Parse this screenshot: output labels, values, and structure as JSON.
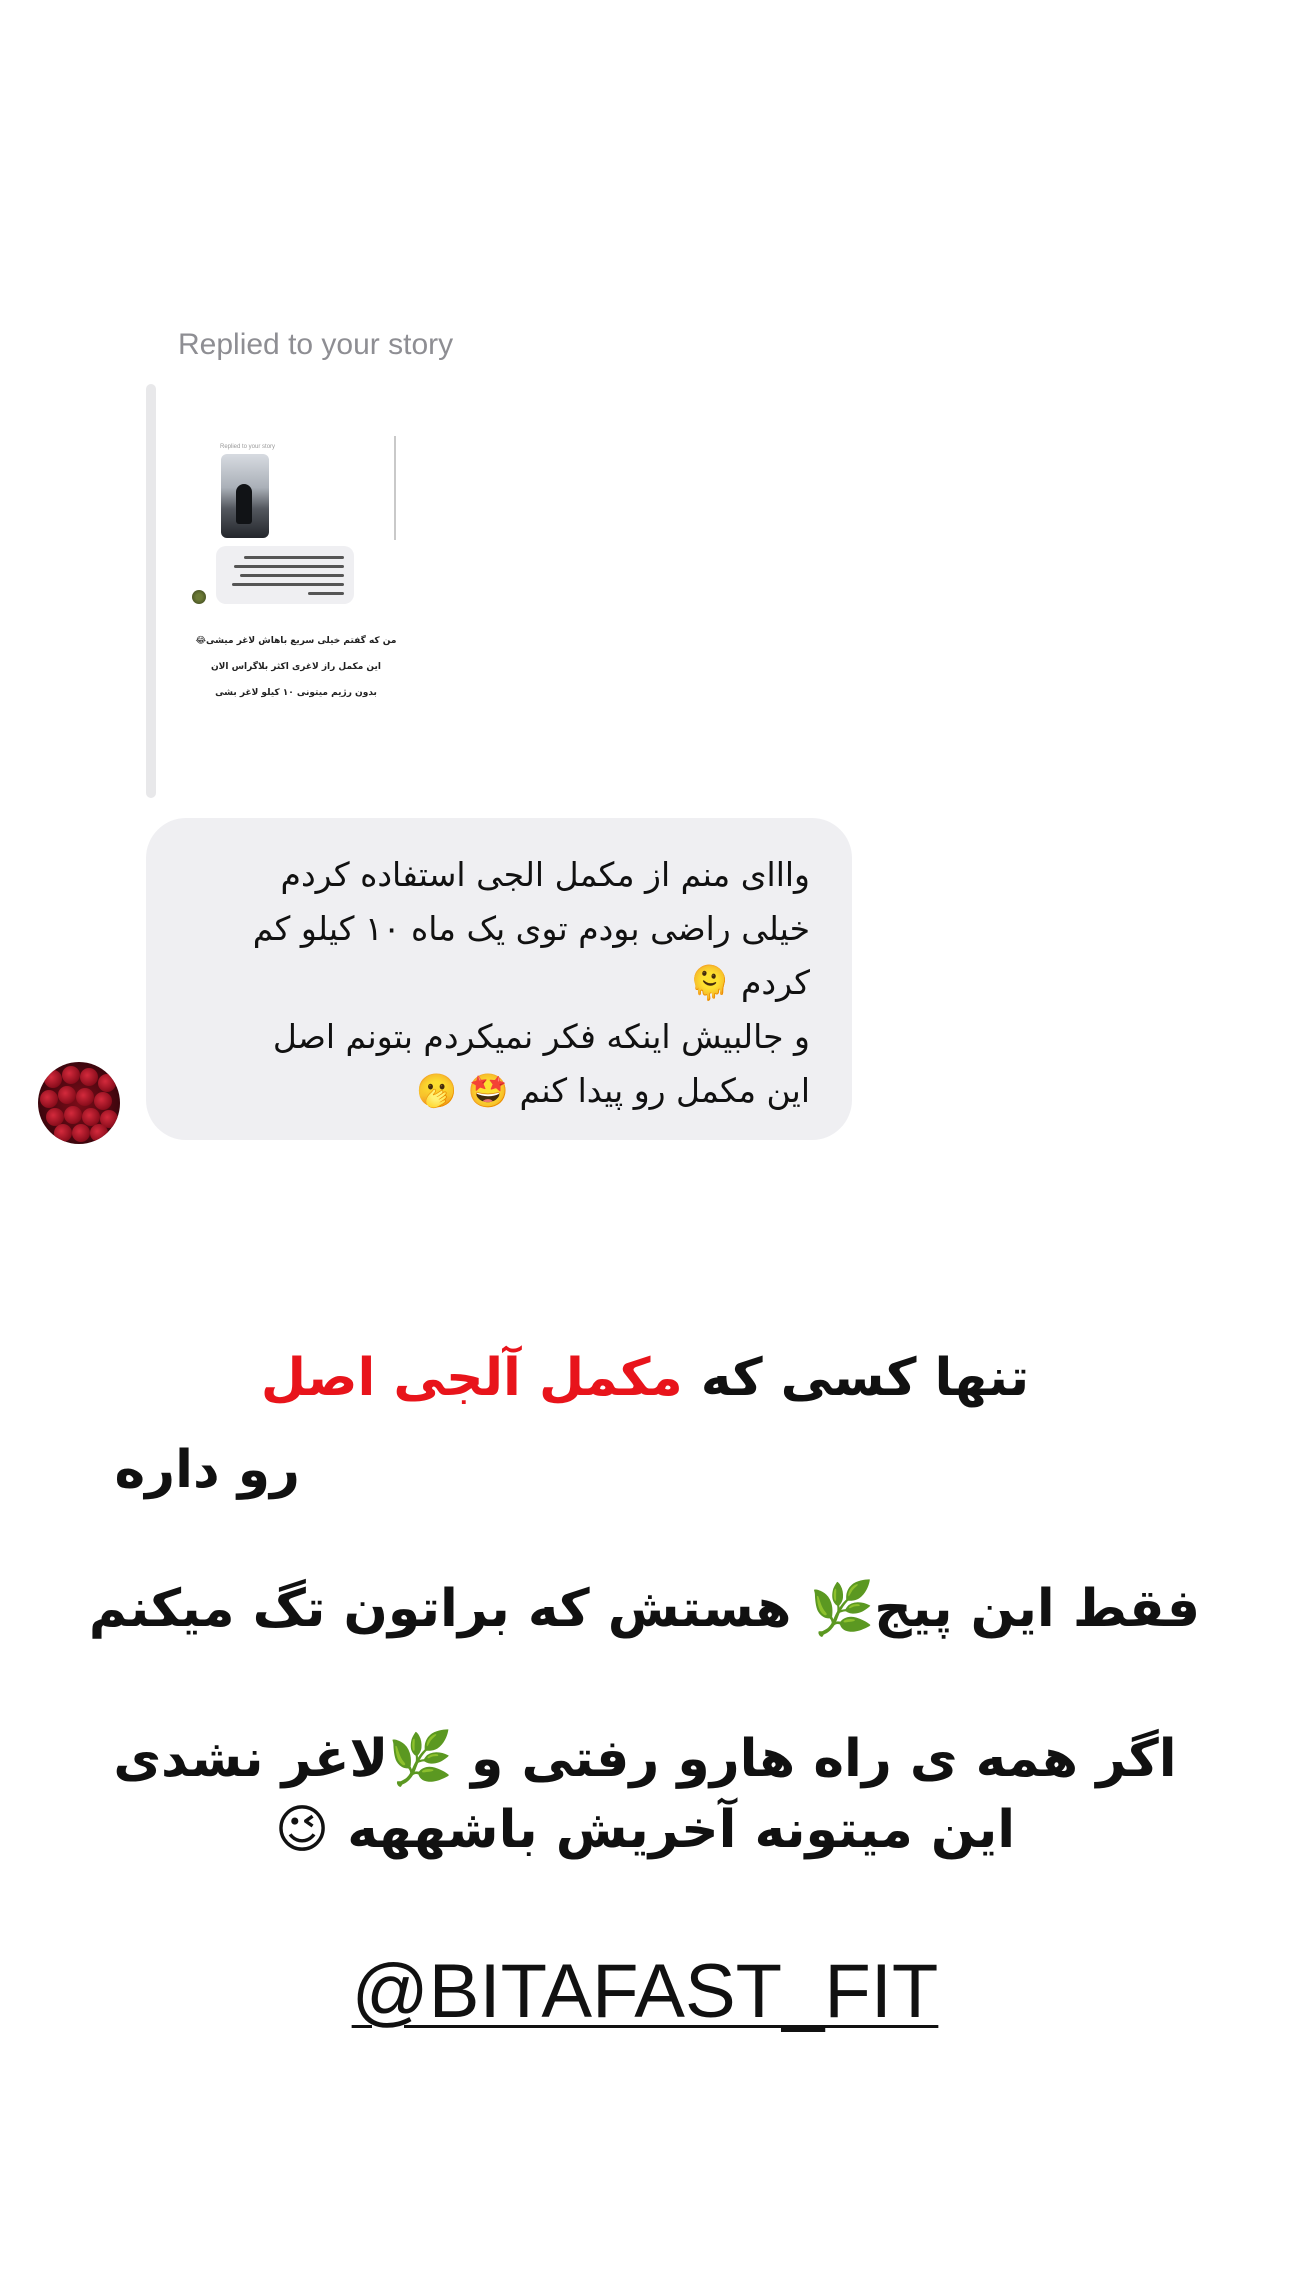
{
  "reply": {
    "label": "Replied to your story"
  },
  "story_preview": {
    "mini_label": "Replied to your story",
    "lines": [
      "من که گفتم خیلی سریع باهاش لاغر میشی😂",
      "این مکمل راز لاغری اکثر بلاگراس الان",
      "بدون رژیم میتونی ۱۰ کیلو لاغر بشی"
    ]
  },
  "message": {
    "text": "وااای منم از مکمل الجی استفاده کردم\nخیلی راضی بودم توی یک ماه ۱۰ کیلو کم\nکردم 🫠\nو جالبیش اینکه فکر نمیکردم بتونم اصل\nاین مکمل رو پیدا کنم 🤩 🫢"
  },
  "promo": {
    "line1_before": "تنها کسی که ",
    "line1_highlight": "مکمل آلجی اصل",
    "line1_after": "رو داره",
    "line2": "فقط این پیج🌿 هستش که براتون تگ میکنم",
    "line3": "اگر همه ی راه هارو رفتی و 🌿لاغر نشدی",
    "line4": "این میتونه آخریش باشههه 😉",
    "accent_color": "#e8141b"
  },
  "handle": "@BITAFAST_FIT"
}
